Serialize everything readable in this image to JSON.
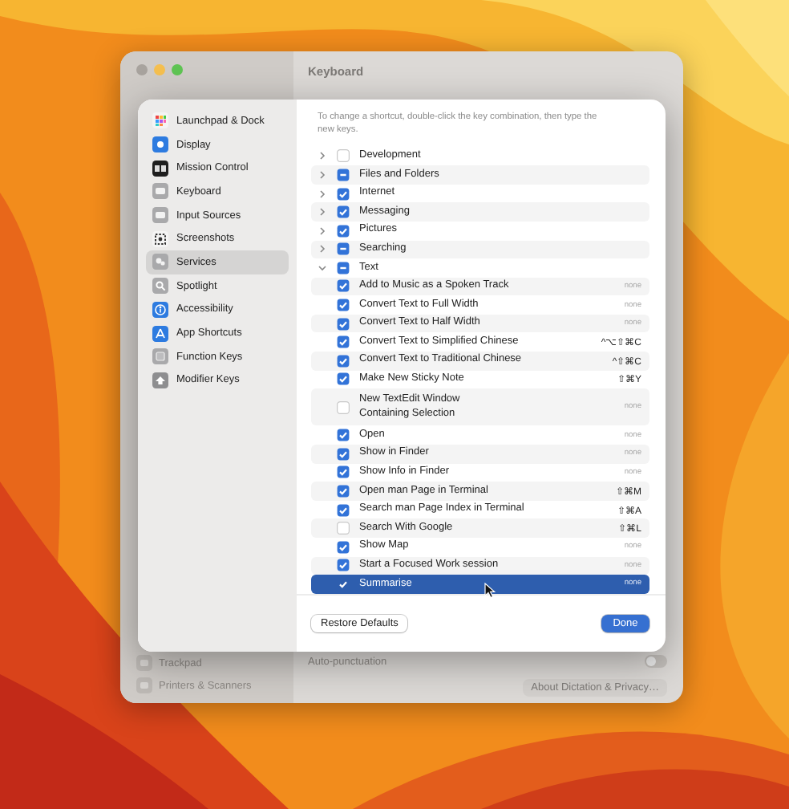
{
  "window": {
    "title": "Keyboard",
    "sidebar_items": [
      {
        "label": "Trackpad"
      },
      {
        "label": "Printers & Scanners"
      }
    ],
    "settings": [
      {
        "label": "Auto-punctuation",
        "kind": "toggle",
        "on": false
      }
    ],
    "about_button": "About Dictation & Privacy…"
  },
  "sheet": {
    "sidebar": [
      {
        "label": "Launchpad & Dock",
        "selected": false
      },
      {
        "label": "Display",
        "selected": false
      },
      {
        "label": "Mission Control",
        "selected": false
      },
      {
        "label": "Keyboard",
        "selected": false
      },
      {
        "label": "Input Sources",
        "selected": false
      },
      {
        "label": "Screenshots",
        "selected": false
      },
      {
        "label": "Services",
        "selected": true
      },
      {
        "label": "Spotlight",
        "selected": false
      },
      {
        "label": "Accessibility",
        "selected": false
      },
      {
        "label": "App Shortcuts",
        "selected": false
      },
      {
        "label": "Function Keys",
        "selected": false
      },
      {
        "label": "Modifier Keys",
        "selected": false
      }
    ],
    "hint": "To change a shortcut, double-click the key combination, then type the new keys.",
    "services": [
      {
        "label": "Development",
        "checked": false,
        "mixed": false,
        "expanded": false
      },
      {
        "label": "Files and Folders",
        "checked": true,
        "mixed": true,
        "expanded": false
      },
      {
        "label": "Internet",
        "checked": true,
        "mixed": false,
        "expanded": false
      },
      {
        "label": "Messaging",
        "checked": true,
        "mixed": false,
        "expanded": false
      },
      {
        "label": "Pictures",
        "checked": true,
        "mixed": false,
        "expanded": false
      },
      {
        "label": "Searching",
        "checked": true,
        "mixed": true,
        "expanded": false
      },
      {
        "label": "Text",
        "checked": true,
        "mixed": true,
        "expanded": true,
        "children": [
          {
            "label": "Add to Music as a Spoken Track",
            "checked": true,
            "shortcut": "none",
            "selected": false
          },
          {
            "label": "Convert Text to Full Width",
            "checked": true,
            "shortcut": "none",
            "selected": false
          },
          {
            "label": "Convert Text to Half Width",
            "checked": true,
            "shortcut": "none",
            "selected": false
          },
          {
            "label": "Convert Text to Simplified Chinese",
            "checked": true,
            "shortcut": "^⌥⇧⌘C",
            "selected": false
          },
          {
            "label": "Convert Text to Traditional Chinese",
            "checked": true,
            "shortcut": "^⇧⌘C",
            "selected": false
          },
          {
            "label": "Make New Sticky Note",
            "checked": true,
            "shortcut": "⇧⌘Y",
            "selected": false
          },
          {
            "label": "New TextEdit Window\nContaining Selection",
            "checked": false,
            "shortcut": "none",
            "selected": false
          },
          {
            "label": "Open",
            "checked": true,
            "shortcut": "none",
            "selected": false
          },
          {
            "label": "Show in Finder",
            "checked": true,
            "shortcut": "none",
            "selected": false
          },
          {
            "label": "Show Info in Finder",
            "checked": true,
            "shortcut": "none",
            "selected": false
          },
          {
            "label": "Open man Page in Terminal",
            "checked": true,
            "shortcut": "⇧⌘M",
            "selected": false
          },
          {
            "label": "Search man Page Index in Terminal",
            "checked": true,
            "shortcut": "⇧⌘A",
            "selected": false
          },
          {
            "label": "Search With Google",
            "checked": false,
            "shortcut": "⇧⌘L",
            "selected": false
          },
          {
            "label": "Show Map",
            "checked": true,
            "shortcut": "none",
            "selected": false
          },
          {
            "label": "Start a Focused Work session",
            "checked": true,
            "shortcut": "none",
            "selected": false
          },
          {
            "label": "Summarise",
            "checked": true,
            "shortcut": "none",
            "selected": true
          }
        ]
      }
    ],
    "buttons": [
      {
        "label": "Restore Defaults",
        "kind": "secondary"
      },
      {
        "label": "Done",
        "kind": "primary"
      }
    ]
  }
}
